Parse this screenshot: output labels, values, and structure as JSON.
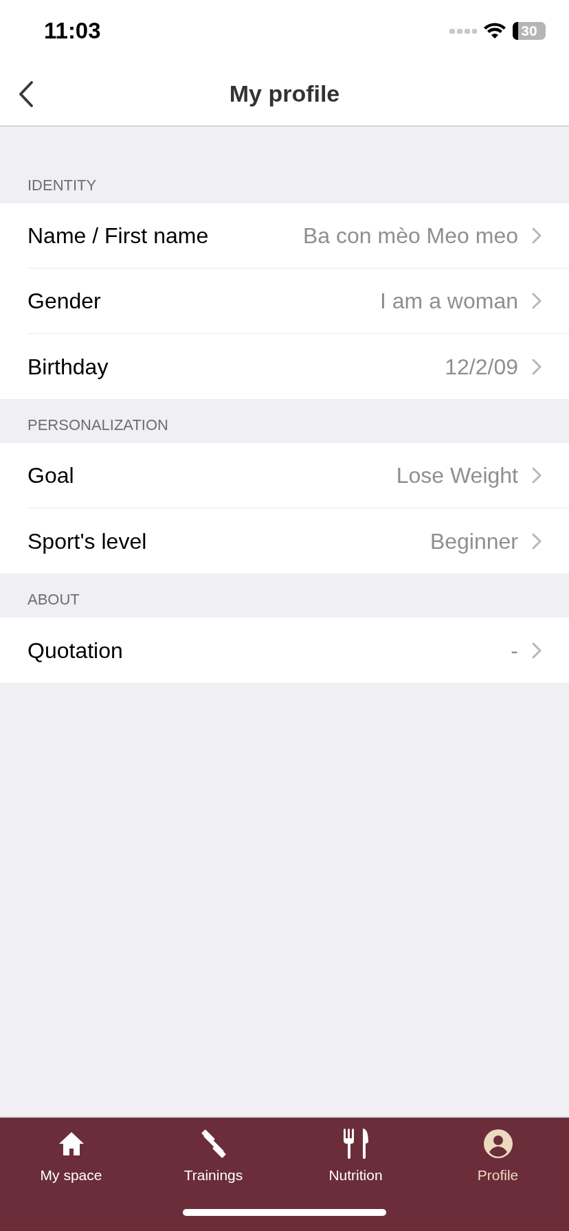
{
  "status_bar": {
    "time": "11:03",
    "battery": "30"
  },
  "nav": {
    "title": "My profile"
  },
  "sections": [
    {
      "header": "IDENTITY",
      "rows": [
        {
          "label": "Name / First name",
          "value": "Ba con mèo Meo meo"
        },
        {
          "label": "Gender",
          "value": "I am a woman"
        },
        {
          "label": "Birthday",
          "value": "12/2/09"
        }
      ]
    },
    {
      "header": "PERSONALIZATION",
      "rows": [
        {
          "label": "Goal",
          "value": "Lose Weight"
        },
        {
          "label": "Sport's level",
          "value": "Beginner"
        }
      ]
    },
    {
      "header": "ABOUT",
      "rows": [
        {
          "label": "Quotation",
          "value": "-"
        }
      ]
    }
  ],
  "tabs": [
    {
      "kind": "home",
      "label": "My space",
      "selected": false
    },
    {
      "kind": "dumbbell",
      "label": "Trainings",
      "selected": false
    },
    {
      "kind": "cutlery",
      "label": "Nutrition",
      "selected": false
    },
    {
      "kind": "person",
      "label": "Profile",
      "selected": true
    }
  ]
}
